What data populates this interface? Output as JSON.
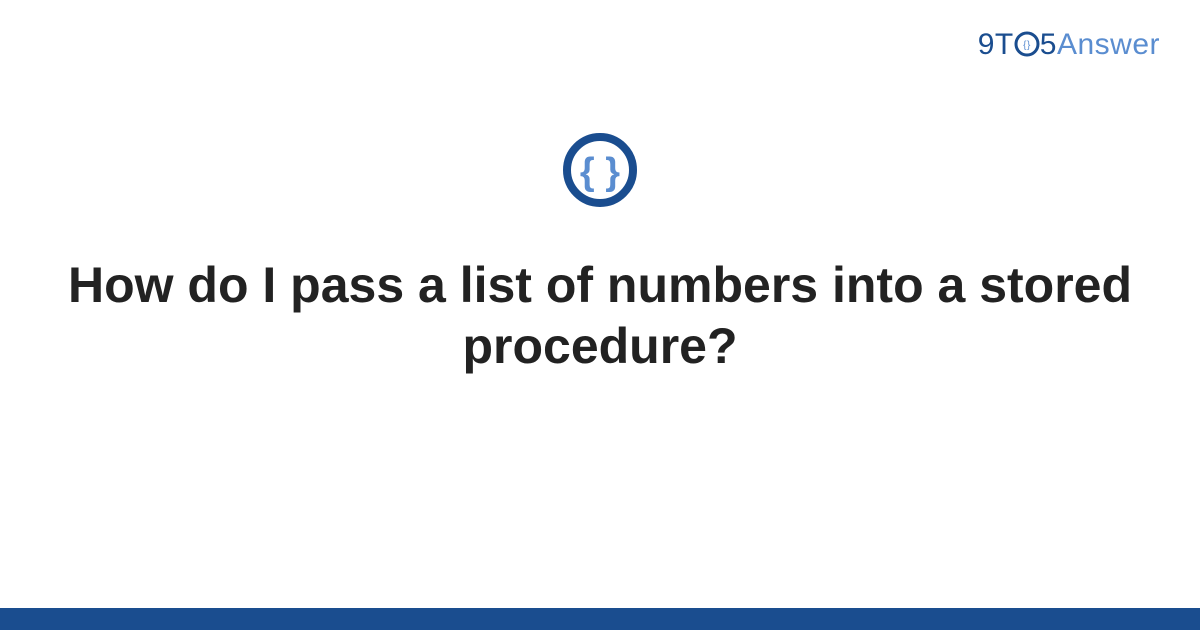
{
  "brand": {
    "part1": "9T",
    "part2": "5",
    "part3": "Answer"
  },
  "question": {
    "title": "How do I pass a list of numbers into a stored procedure?"
  },
  "colors": {
    "primary": "#1a4d8f",
    "secondary": "#5a8dd0",
    "text": "#222222"
  }
}
